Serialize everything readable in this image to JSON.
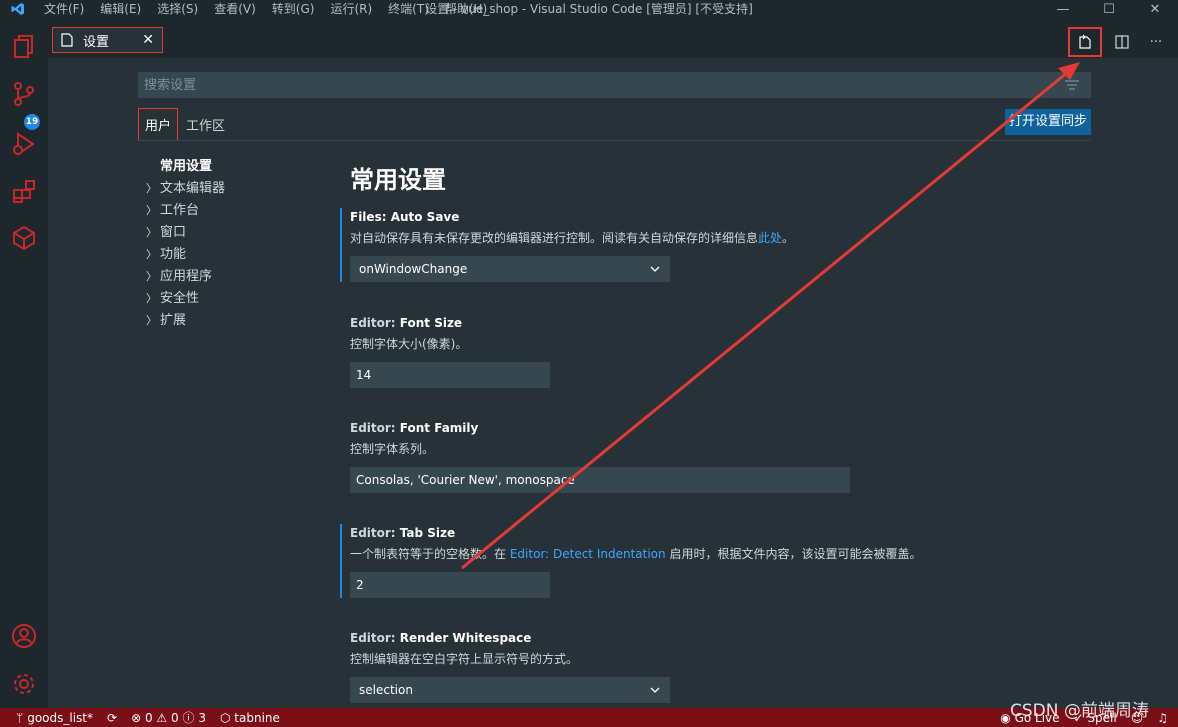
{
  "titlebar": {
    "menu": [
      "文件(F)",
      "编辑(E)",
      "选择(S)",
      "查看(V)",
      "转到(G)",
      "运行(R)",
      "终端(T)",
      "帮助(H)"
    ],
    "title": "设置 - vue_shop - Visual Studio Code [管理员] [不受支持]"
  },
  "activity": {
    "scm_badge": "19"
  },
  "tab": {
    "label": "设置",
    "close": "✕"
  },
  "search": {
    "placeholder": "搜索设置"
  },
  "scopes": {
    "user": "用户",
    "workspace": "工作区"
  },
  "sync_button": "打开设置同步",
  "toc": {
    "heading": "常用设置",
    "items": [
      "文本编辑器",
      "工作台",
      "窗口",
      "功能",
      "应用程序",
      "安全性",
      "扩展"
    ]
  },
  "section_title": "常用设置",
  "settings": [
    {
      "category": "Files: ",
      "name": "Auto Save",
      "desc": "对自动保存具有未保存更改的编辑器进行控制。阅读有关自动保存的详细信息",
      "link": "此处",
      "desc_end": "。",
      "value": "onWindowChange"
    },
    {
      "category": "Editor: ",
      "name": "Font Size",
      "desc": "控制字体大小(像素)。",
      "value": "14"
    },
    {
      "category": "Editor: ",
      "name": "Font Family",
      "desc": "控制字体系列。",
      "value": "Consolas, 'Courier New', monospace"
    },
    {
      "category": "Editor: ",
      "name": "Tab Size",
      "desc": "一个制表符等于的空格数。在 ",
      "link": "Editor: Detect Indentation",
      "desc_end": " 启用时，根据文件内容，该设置可能会被覆盖。",
      "value": "2"
    },
    {
      "category": "Editor: ",
      "name": "Render Whitespace",
      "desc": "控制编辑器在空白字符上显示符号的方式。",
      "value": "selection"
    }
  ],
  "statusbar": {
    "branch": "goods_list*",
    "errors": "0",
    "warnings": "0",
    "info": "3",
    "tabnine": "tabnine",
    "golive": "Go Live",
    "spell": "Spell"
  },
  "watermark": "CSDN @前端周涛",
  "colors": {
    "accent": "#e53935",
    "statusbar": "#7a0f16",
    "link": "#3ea6ff",
    "button": "#0e639c"
  }
}
